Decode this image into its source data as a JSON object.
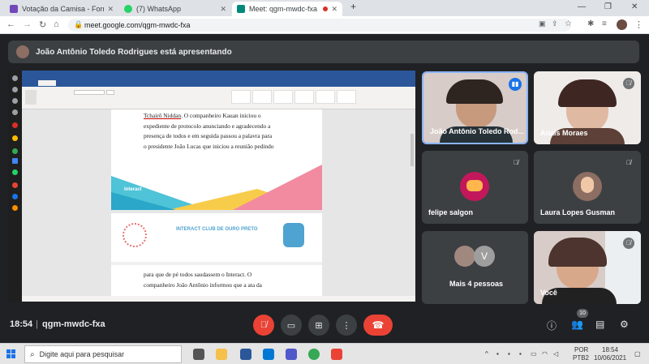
{
  "browser": {
    "tabs": [
      {
        "title": "Votação da Camisa - Formulários",
        "favicon_color": "#7248b9",
        "active": false
      },
      {
        "title": "(7) WhatsApp",
        "favicon_color": "#25d366",
        "active": false
      },
      {
        "title": "Meet: qgm-mwdc-fxa",
        "favicon_color": "#00897b",
        "active": true
      }
    ],
    "new_tab": "+",
    "url": "meet.google.com/qgm-mwdc-fxa"
  },
  "meet": {
    "presenter_banner": "João Antônio Toledo Rodrigues está apresentando",
    "shared_doc": {
      "page1_lines": [
        ". O companheiro Kauan iniciou o",
        "expediente de protocolo anunciando e agradecendo a",
        "presença de todos e em seguida passou a palavra para",
        "o presidente João Lucas que iniciou a reunião pedindo"
      ],
      "page1_underlined": "Tchairô Niddan",
      "banner_brand": "Interact",
      "letterhead_title": "INTERACT CLUB DE OURO PRETO",
      "page2_lines": [
        "para que de pé todos saudassem o Interact. O",
        "companheiro João Antônio informou que a ata da"
      ]
    },
    "participants": [
      {
        "name": "João Antônio Toledo Rod...",
        "muted": false,
        "speaking": true
      },
      {
        "name": "Anaís Moraes",
        "muted": true
      },
      {
        "name": "felipe salgon",
        "muted": true
      },
      {
        "name": "Laura Lopes Gusman",
        "muted": true
      },
      {
        "name": "Mais 4 pessoas",
        "avatar_letter": "V"
      },
      {
        "name": "Você",
        "muted": true
      }
    ],
    "clock": "18:54",
    "separator": "|",
    "meeting_code": "qgm-mwdc-fxa",
    "participant_count": "10"
  },
  "taskbar": {
    "search_placeholder": "Digite aqui para pesquisar",
    "lang_top": "POR",
    "lang_bottom": "PTB2",
    "time": "18:54",
    "date": "10/06/2021"
  }
}
